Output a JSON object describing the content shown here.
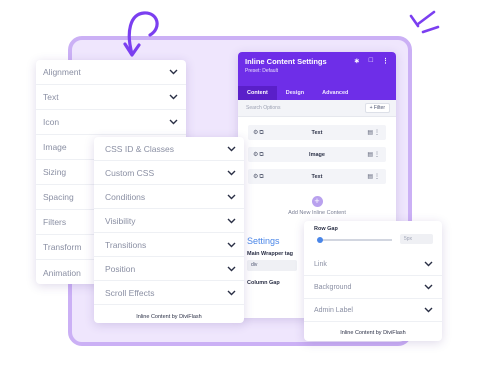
{
  "left_panel": {
    "items": [
      "Alignment",
      "Text",
      "Icon",
      "Image",
      "Sizing",
      "Spacing",
      "Filters",
      "Transform",
      "Animation"
    ]
  },
  "middle_panel": {
    "items": [
      "CSS ID & Classes",
      "Custom CSS",
      "Conditions",
      "Visibility",
      "Transitions",
      "Position",
      "Scroll Effects"
    ],
    "footer": "Inline Content by DiviFlash"
  },
  "settings_panel": {
    "title": "Inline Content Settings",
    "preset": "Preset: Default",
    "tabs": [
      "Content",
      "Design",
      "Advanced"
    ],
    "search_placeholder": "Search Options",
    "filter_label": "+ Filter",
    "items": [
      "Text",
      "Image",
      "Text"
    ],
    "add_label": "Add New Inline Content",
    "section_title": "Settings",
    "main_wrapper_label": "Main Wrapper tag",
    "main_wrapper_value": "div",
    "column_gap_label": "Column Gap"
  },
  "right_panel": {
    "row_gap_label": "Row Gap",
    "row_gap_value": "5px",
    "row_gap_level": 0.03,
    "items": [
      "Link",
      "Background",
      "Admin Label"
    ],
    "footer": "Inline Content by DiviFlash"
  },
  "colors": {
    "accent": "#6e2ee8",
    "accent_dark": "#5a1fc9",
    "link_blue": "#4a86e8",
    "background_panel": "#efe6fd"
  }
}
